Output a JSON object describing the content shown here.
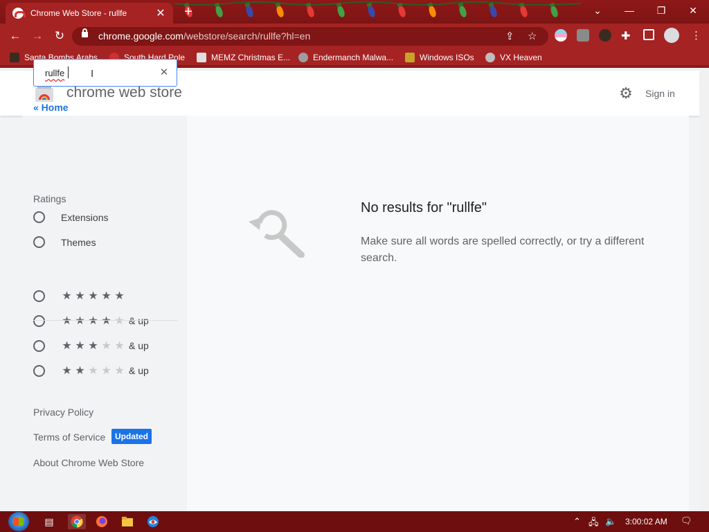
{
  "browser": {
    "tab_title": "Chrome Web Store - rullfe",
    "tab_close": "✕",
    "new_tab": "+",
    "url_host": "chrome.google.com",
    "url_path": "/webstore/search/rullfe?hl=en",
    "window_controls": [
      "⌄",
      "—",
      "❐",
      "✕"
    ]
  },
  "bookmarks": [
    {
      "label": "Santa Bombs Arabs",
      "icon": "bookmark-icon-1",
      "color": "#3a2a20"
    },
    {
      "label": "South Hard Pole",
      "icon": "bookmark-icon-2",
      "color": "#d32f2f"
    },
    {
      "label": "MEMZ Christmas E...",
      "icon": "bookmark-icon-3",
      "color": "#e0e0e0"
    },
    {
      "label": "Endermanch Malwa...",
      "icon": "bookmark-icon-4",
      "color": "#9e9e9e"
    },
    {
      "label": "Windows ISOs",
      "icon": "bookmark-icon-5",
      "color": "#c9a227"
    },
    {
      "label": "VX Heaven",
      "icon": "bookmark-icon-6",
      "color": "#bdbdbd"
    }
  ],
  "store": {
    "title": "chrome web store",
    "sign_in": "Sign in"
  },
  "search": {
    "value": "rullfe"
  },
  "sidebar": {
    "home_link": "« Home",
    "types": [
      "Extensions",
      "Themes"
    ],
    "ratings_heading": "Ratings",
    "ratings": [
      {
        "stars": 5,
        "suffix": ""
      },
      {
        "stars": 4,
        "suffix": "& up"
      },
      {
        "stars": 3,
        "suffix": "& up"
      },
      {
        "stars": 2,
        "suffix": "& up"
      }
    ],
    "privacy_policy": "Privacy Policy",
    "terms_of_service": "Terms of Service",
    "updated_badge": "Updated",
    "about": "About Chrome Web Store"
  },
  "results": {
    "title": "No results for \"rullfe\"",
    "message": "Make sure all words are spelled correctly, or try a different search."
  },
  "taskbar": {
    "clock": "3:00:02 AM"
  },
  "colors": {
    "frame": "#a52323",
    "link": "#1a73e8"
  }
}
